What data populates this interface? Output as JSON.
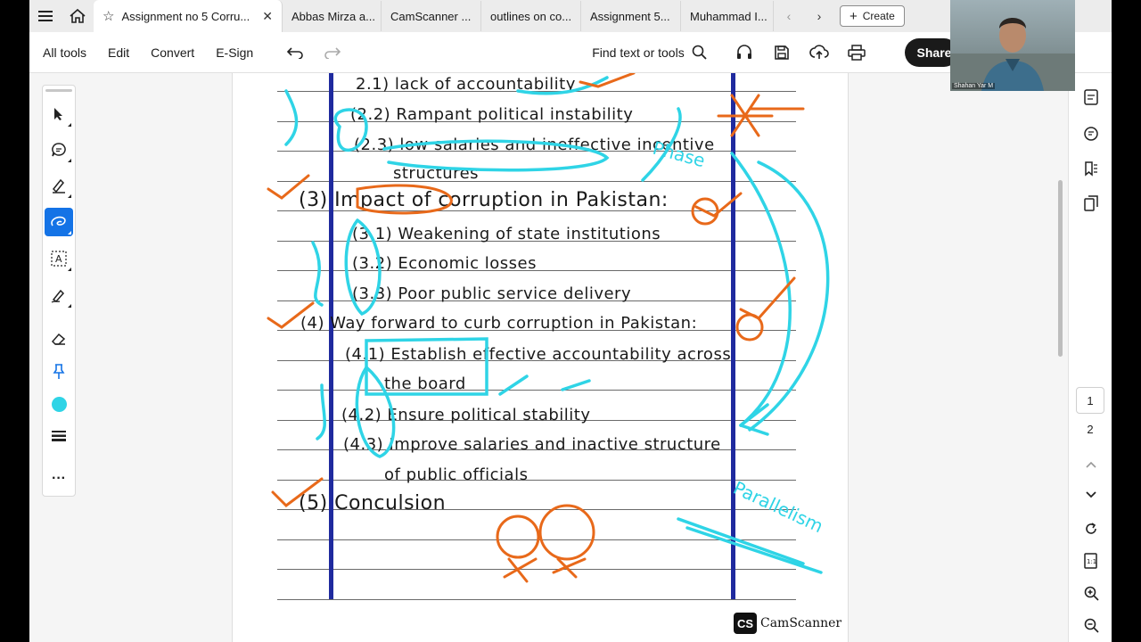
{
  "tabs": [
    {
      "label": "Assignment no 5 Corru...",
      "active": true
    },
    {
      "label": "Abbas Mirza a..."
    },
    {
      "label": "CamScanner ..."
    },
    {
      "label": "outlines on co..."
    },
    {
      "label": "Assignment 5..."
    },
    {
      "label": "Muhammad I..."
    }
  ],
  "create_label": "Create",
  "toolbar": {
    "items": [
      "All tools",
      "Edit",
      "Convert",
      "E-Sign"
    ],
    "find_label": "Find text or tools",
    "share_label": "Share"
  },
  "left_tools": [
    "select-tool",
    "comment-tool",
    "highlight-tool",
    "draw-tool",
    "text-tool",
    "sign-tool",
    "eraser-tool",
    "pin-tool",
    "color-tool",
    "thickness-tool",
    "more-tool"
  ],
  "document": {
    "lines": [
      {
        "text": "2.1) lack of accountability"
      },
      {
        "text": "(2.2) Rampant political instability"
      },
      {
        "text": "(2.3) low salaries and ineffective incentive"
      },
      {
        "text": "structures"
      },
      {
        "text": "(3) Impact of corruption in Pakistan:"
      },
      {
        "text": "(3.1) Weakening of state institutions"
      },
      {
        "text": "(3.2) Economic losses"
      },
      {
        "text": "(3.3) Poor public service delivery"
      },
      {
        "text": "(4) Way forward to curb corruption in Pakistan:"
      },
      {
        "text": "(4.1) Establish effective accountability across"
      },
      {
        "text": "the board"
      },
      {
        "text": "(4.2) Ensure political stability"
      },
      {
        "text": "(4.3) Improve salaries and inactive structure"
      },
      {
        "text": "of public officials"
      },
      {
        "text": "(5) Conculsion"
      }
    ],
    "annotations": [
      "Phase",
      "Parallelism"
    ],
    "watermark": "CamScanner",
    "watermark_logo": "CS"
  },
  "pages": {
    "current": "1",
    "total": "2"
  },
  "webcam": {
    "caption": "Shahan Yar M"
  },
  "colors": {
    "ink_blue": "#1f2a9e",
    "annot_cyan": "#2fd4e6",
    "annot_orange": "#e8691a",
    "accent": "#1473e6"
  }
}
